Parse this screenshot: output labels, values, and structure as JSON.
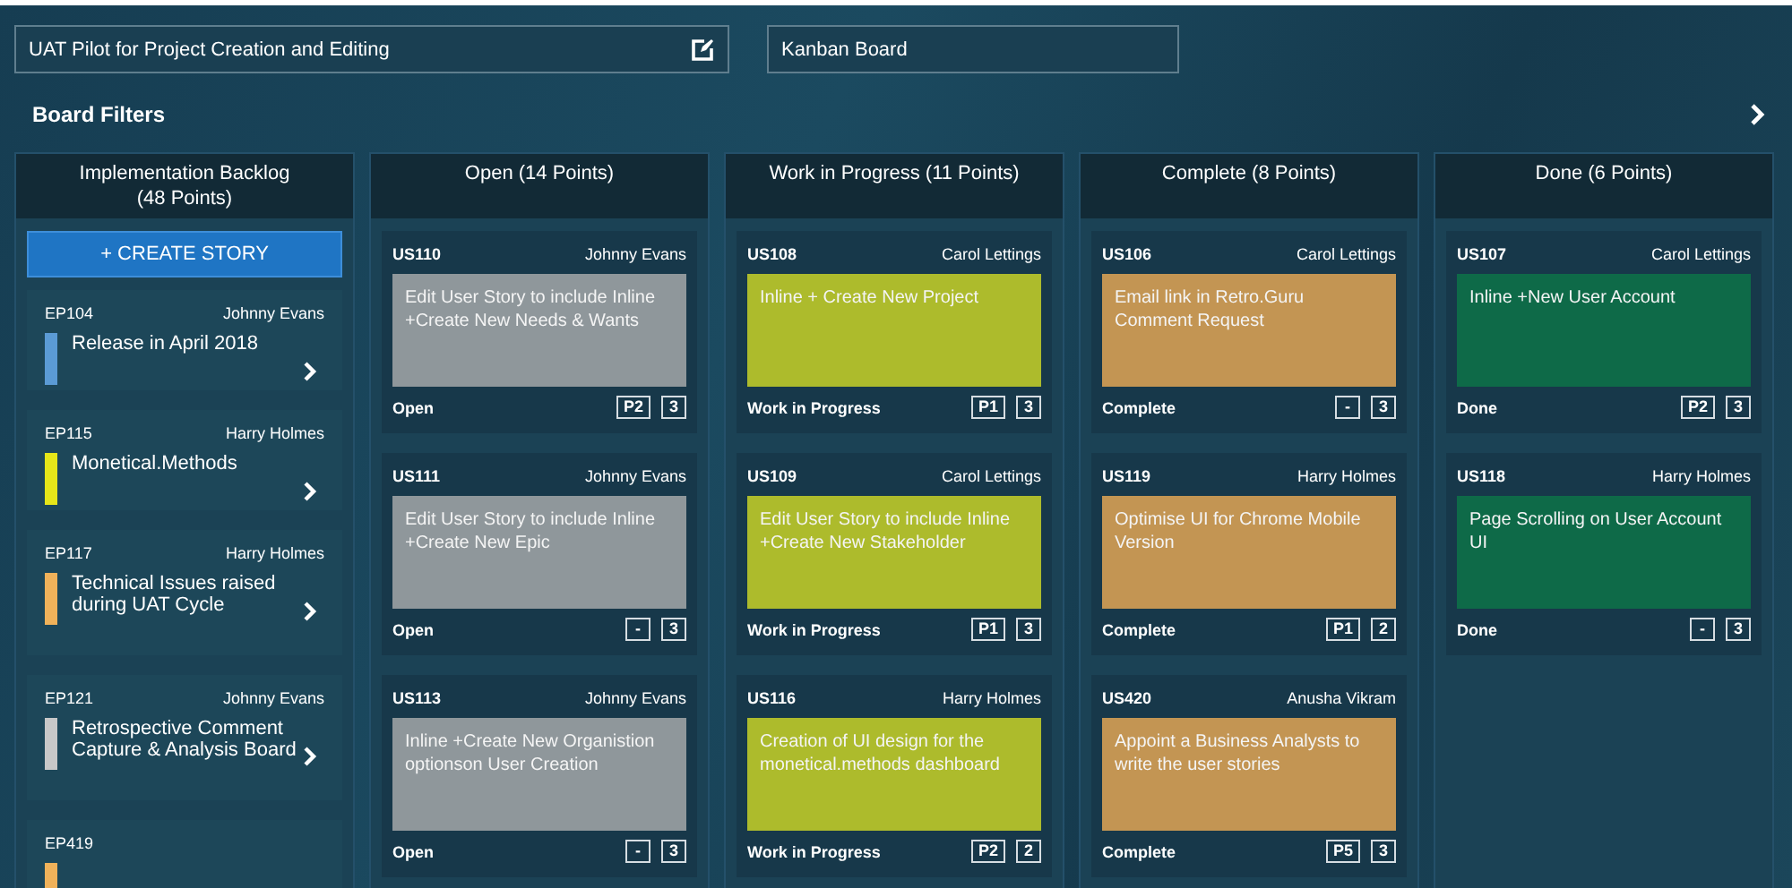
{
  "header": {
    "project_title": "UAT Pilot for Project Creation and Editing",
    "board_name": "Kanban Board",
    "filters_label": "Board Filters"
  },
  "backlog": {
    "title": "Implementation Backlog",
    "points": "(48 Points)",
    "create_button": "+ CREATE STORY",
    "epics": [
      {
        "id": "EP104",
        "owner": "Johnny Evans",
        "title": "Release in April 2018",
        "color": "#5b9bd5"
      },
      {
        "id": "EP115",
        "owner": "Harry Holmes",
        "title": "Monetical.Methods",
        "color": "#e6e619"
      },
      {
        "id": "EP117",
        "owner": "Harry Holmes",
        "title": "Technical Issues raised during UAT Cycle",
        "color": "#f0b25a"
      },
      {
        "id": "EP121",
        "owner": "Johnny Evans",
        "title": "Retrospective Comment Capture & Analysis Board",
        "color": "#c8c8c8"
      },
      {
        "id": "EP419",
        "color": "#f0b25a"
      }
    ]
  },
  "columns": [
    {
      "title": "Open (14 Points)",
      "cards": [
        {
          "id": "US110",
          "owner": "Johnny Evans",
          "text": "Edit User Story to include Inline +Create New Needs & Wants",
          "status": "Open",
          "priority": "P2",
          "points": "3",
          "color": "#8f979b"
        },
        {
          "id": "US111",
          "owner": "Johnny Evans",
          "text": "Edit User Story to include Inline +Create New Epic",
          "status": "Open",
          "priority": "-",
          "points": "3",
          "color": "#8f979b"
        },
        {
          "id": "US113",
          "owner": "Johnny Evans",
          "text": "Inline +Create New Organistion optionson User Creation",
          "status": "Open",
          "priority": "-",
          "points": "3",
          "color": "#8f979b"
        }
      ]
    },
    {
      "title": "Work in Progress (11 Points)",
      "cards": [
        {
          "id": "US108",
          "owner": "Carol Lettings",
          "text": "Inline + Create New Project",
          "status": "Work in Progress",
          "priority": "P1",
          "points": "3",
          "color": "#adbb2c"
        },
        {
          "id": "US109",
          "owner": "Carol Lettings",
          "text": "Edit User Story to include Inline +Create New Stakeholder",
          "status": "Work in Progress",
          "priority": "P1",
          "points": "3",
          "color": "#adbb2c"
        },
        {
          "id": "US116",
          "owner": "Harry Holmes",
          "text": "Creation of UI design for the monetical.methods dashboard",
          "status": "Work in Progress",
          "priority": "P2",
          "points": "2",
          "color": "#adbb2c"
        }
      ]
    },
    {
      "title": "Complete (8 Points)",
      "cards": [
        {
          "id": "US106",
          "owner": "Carol Lettings",
          "text": "Email link in Retro.Guru Comment Request",
          "status": "Complete",
          "priority": "-",
          "points": "3",
          "color": "#c39553"
        },
        {
          "id": "US119",
          "owner": "Harry Holmes",
          "text": "Optimise UI for Chrome Mobile Version",
          "status": "Complete",
          "priority": "P1",
          "points": "2",
          "color": "#c39553"
        },
        {
          "id": "US420",
          "owner": "Anusha Vikram",
          "text": "Appoint a Business Analysts to write the user stories",
          "status": "Complete",
          "priority": "P5",
          "points": "3",
          "color": "#c39553"
        }
      ]
    },
    {
      "title": "Done (6 Points)",
      "cards": [
        {
          "id": "US107",
          "owner": "Carol Lettings",
          "text": "Inline +New User Account",
          "status": "Done",
          "priority": "P2",
          "points": "3",
          "color": "#0e6a48"
        },
        {
          "id": "US118",
          "owner": "Harry Holmes",
          "text": "Page Scrolling on User Account UI",
          "status": "Done",
          "priority": "-",
          "points": "3",
          "color": "#0e6a48"
        }
      ]
    }
  ]
}
